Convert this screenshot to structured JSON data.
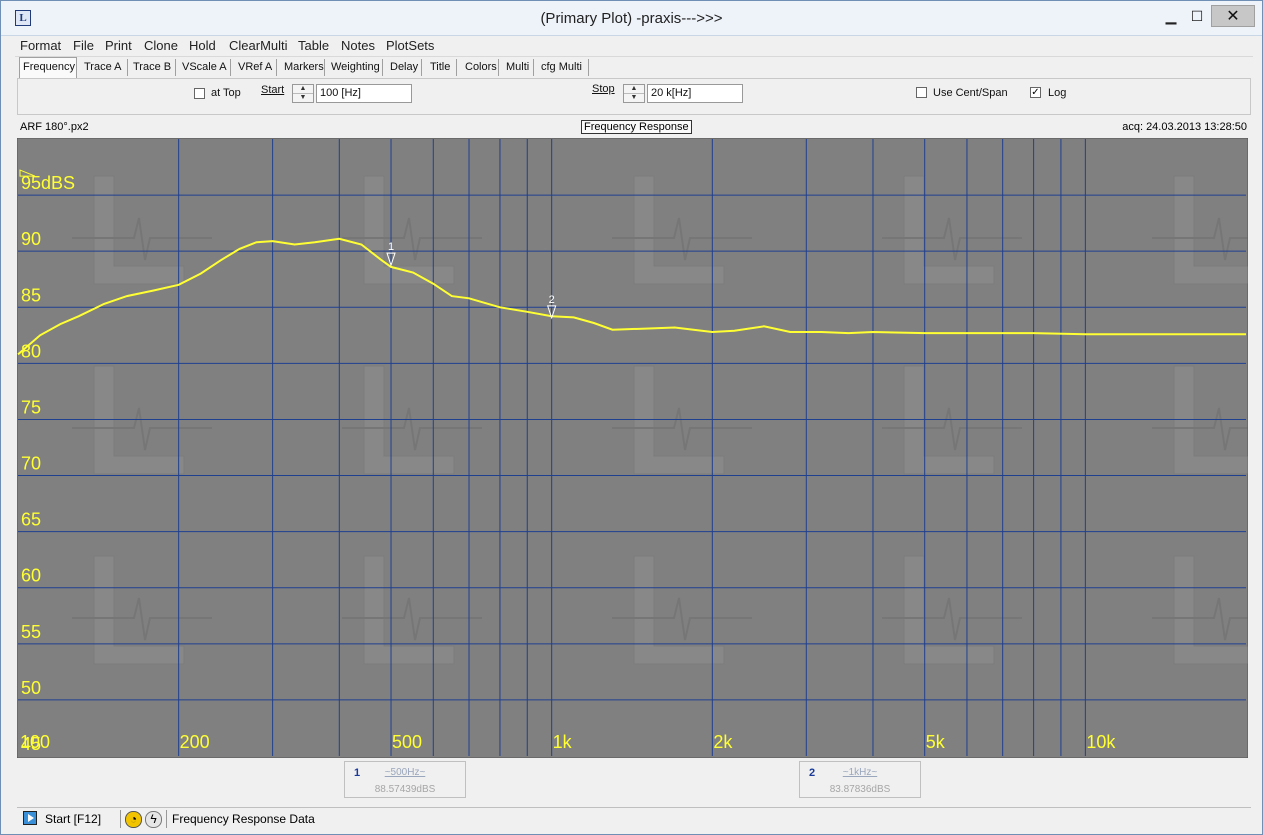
{
  "window": {
    "title": "(Primary Plot) -praxis--->>>",
    "app_icon": "L",
    "minimize": "▁",
    "maximize": "☐",
    "close": "✕"
  },
  "menu": [
    "Format",
    "File",
    "Print",
    "Clone",
    "Hold",
    "ClearMulti",
    "Table",
    "Notes",
    "PlotSets"
  ],
  "tabs": [
    "Frequency",
    "Trace A",
    "Trace B",
    "VScale A",
    "VRef A",
    "Markers",
    "Weighting",
    "Delay",
    "Title",
    "Colors",
    "Multi",
    "cfg Multi"
  ],
  "controls": {
    "at_top_label": "at Top",
    "start_label": "Start",
    "start_value": "100 [Hz]",
    "stop_label": "Stop",
    "stop_value": "20 k[Hz]",
    "cent_span_label": "Use Cent/Span",
    "log_label": "Log",
    "log_checked": "✓"
  },
  "info": {
    "file": "ARF 180°.px2",
    "plot_title": "Frequency Response",
    "acq": "acq: 24.03.2013 13:28:50"
  },
  "chart_data": {
    "type": "line",
    "title": "Frequency Response",
    "x_scale": "log",
    "xlim": [
      100,
      20000
    ],
    "ylim": [
      45,
      100
    ],
    "y_unit_label": "95dBS",
    "y_ticks": [
      95,
      90,
      85,
      80,
      75,
      70,
      65,
      60,
      55,
      50,
      45
    ],
    "y_tick_labels": [
      "95dBS",
      "90",
      "85",
      "80",
      "75",
      "70",
      "65",
      "60",
      "55",
      "50",
      "45"
    ],
    "x_tick_labels": [
      {
        "value": 100,
        "label": "100"
      },
      {
        "value": 200,
        "label": "200"
      },
      {
        "value": 500,
        "label": "500"
      },
      {
        "value": 1000,
        "label": "1k"
      },
      {
        "value": 2000,
        "label": "2k"
      },
      {
        "value": 5000,
        "label": "5k"
      },
      {
        "value": 10000,
        "label": "10k"
      }
    ],
    "grid": true,
    "background": "#808080",
    "grid_color": "#1f3f8f",
    "series": [
      {
        "color": "#ffff33",
        "x": [
          100,
          110,
          120,
          130,
          145,
          160,
          180,
          200,
          220,
          240,
          260,
          280,
          300,
          330,
          360,
          400,
          440,
          480,
          500,
          550,
          600,
          650,
          700,
          800,
          900,
          1000,
          1100,
          1200,
          1300,
          1500,
          1700,
          2000,
          2200,
          2500,
          2800,
          3200,
          3600,
          4000,
          5000,
          6000,
          8000,
          10000,
          14000,
          20000
        ],
        "y": [
          80.8,
          82.5,
          83.5,
          84.2,
          85.3,
          86.0,
          86.5,
          87.0,
          88.0,
          89.2,
          90.2,
          90.8,
          90.9,
          90.6,
          90.8,
          91.1,
          90.6,
          89.2,
          88.6,
          88.1,
          87.1,
          86.0,
          85.8,
          85.0,
          84.6,
          84.2,
          84.1,
          83.6,
          83.0,
          83.1,
          83.2,
          82.8,
          82.9,
          83.3,
          82.8,
          82.8,
          82.7,
          82.8,
          82.7,
          82.7,
          82.7,
          82.6,
          82.6,
          82.6
        ]
      }
    ],
    "markers": [
      {
        "id": "1",
        "x": 500,
        "y": 88.57439,
        "freq_label": "~500Hz~",
        "level_label": "88.57439dBS"
      },
      {
        "id": "2",
        "x": 1000,
        "y": 83.87836,
        "freq_label": "~1kHz~",
        "level_label": "83.87836dBS"
      }
    ]
  },
  "status": {
    "start": "Start [F12]",
    "text": "Frequency Response Data",
    "icons": [
      "clock-icon",
      "lightning-icon"
    ]
  }
}
